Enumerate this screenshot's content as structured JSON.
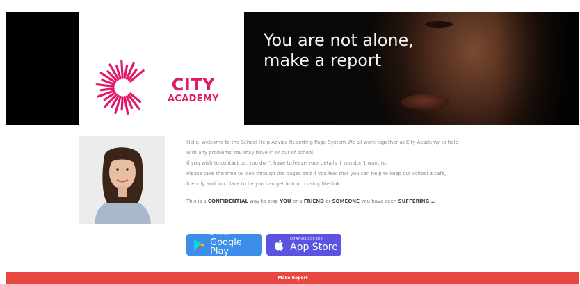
{
  "hero": {
    "title_line1": "You are not alone,",
    "title_line2": "make a report",
    "brand_line1": "CITY",
    "brand_line2": "ACADEMY"
  },
  "intro": {
    "lines": [
      "Hello, welcome to the School Help Advice Reporting Page System We all work together at City Academy to help",
      "with any problems you may have in or out of school.",
      "If you wish to contact us, you don't have to leave your details if you don't want to.",
      "Please take the time to look through the pages and if you feel that you can help to keep our school a safe,",
      "friendly and fun place to be you can get in touch using the link."
    ],
    "confidential": {
      "t1": "This is a ",
      "b1": "CONFIDENTIAL",
      "t2": " way to stop ",
      "b2": "YOU",
      "t3": " or a ",
      "b3": "FRIEND",
      "t4": " or ",
      "b4": "SOMEONE",
      "t5": " you have seen ",
      "b5": "SUFFERING..."
    }
  },
  "badges": {
    "google_small": "GET IT ON",
    "google_big": "Google Play",
    "apple_small": "Download on the",
    "apple_big": "App Store"
  },
  "report_button": "Make Report",
  "colors": {
    "brand_pink": "#e0196a",
    "report_red": "#e8473f",
    "google_badge": "#3d8ee8",
    "apple_badge": "#5b54e0"
  }
}
